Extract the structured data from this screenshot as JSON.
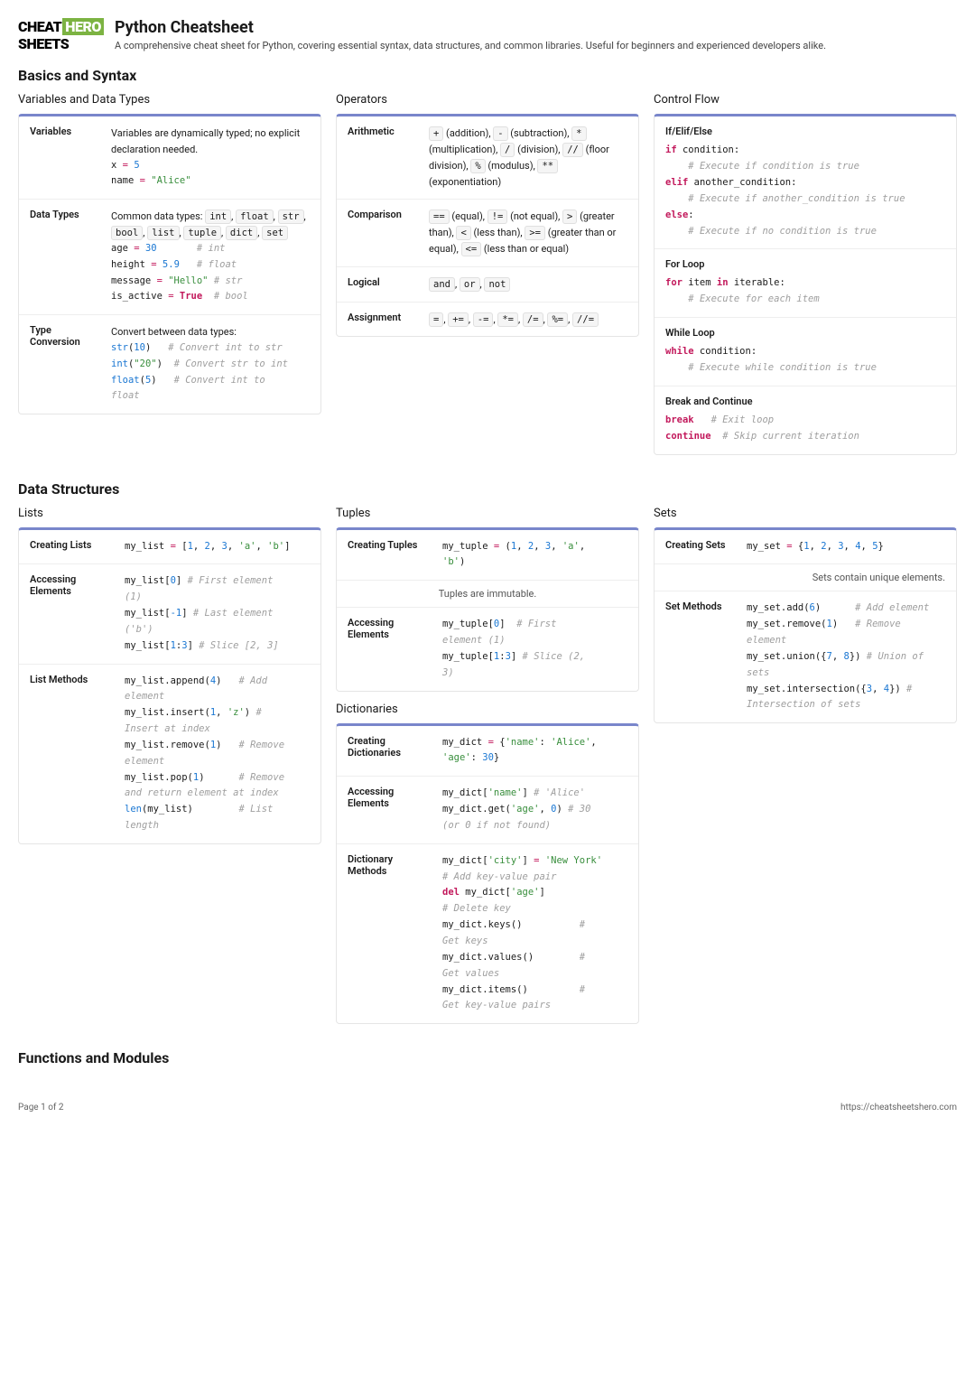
{
  "header": {
    "logo": {
      "cheat": "CHEAT",
      "sheets": "SHEETS",
      "hero": "HERO"
    },
    "title": "Python Cheatsheet",
    "subtitle": "A comprehensive cheat sheet for Python, covering essential syntax, data structures, and common libraries. Useful for beginners and experienced developers alike."
  },
  "sections": {
    "basics": {
      "title": "Basics and Syntax"
    },
    "datastructs": {
      "title": "Data Structures"
    },
    "funcs": {
      "title": "Functions and Modules"
    }
  },
  "vars_title": "Variables and Data Types",
  "vars_rows": {
    "variables": {
      "label": "Variables",
      "text": "Variables are dynamically typed; no explicit declaration needed."
    },
    "datatypes": {
      "label": "Data Types",
      "text": "Common data types: "
    },
    "typeconv": {
      "label": "Type Conversion",
      "text": "Convert between data types:"
    }
  },
  "ops_title": "Operators",
  "ops": {
    "arithmetic": {
      "label": "Arithmetic"
    },
    "comparison": {
      "label": "Comparison"
    },
    "logical": {
      "label": "Logical"
    },
    "assignment": {
      "label": "Assignment"
    }
  },
  "ctrl_title": "Control Flow",
  "ctrl": {
    "ifelse": "If/Elif/Else",
    "for": "For Loop",
    "while": "While Loop",
    "break": "Break and Continue"
  },
  "lists_title": "Lists",
  "lists": {
    "create": "Creating Lists",
    "access": "Accessing Elements",
    "methods": "List Methods"
  },
  "tuples_title": "Tuples",
  "tuples": {
    "create": "Creating Tuples",
    "note": "Tuples are immutable.",
    "access": "Accessing Elements"
  },
  "dicts_title": "Dictionaries",
  "dicts": {
    "create": "Creating Dictionaries",
    "access": "Accessing Elements",
    "methods": "Dictionary Methods"
  },
  "sets_title": "Sets",
  "sets": {
    "create": "Creating Sets",
    "note": "Sets contain unique elements.",
    "methods": "Set Methods"
  },
  "footer": {
    "page": "Page 1 of 2",
    "url": "https://cheatsheetshero.com"
  }
}
